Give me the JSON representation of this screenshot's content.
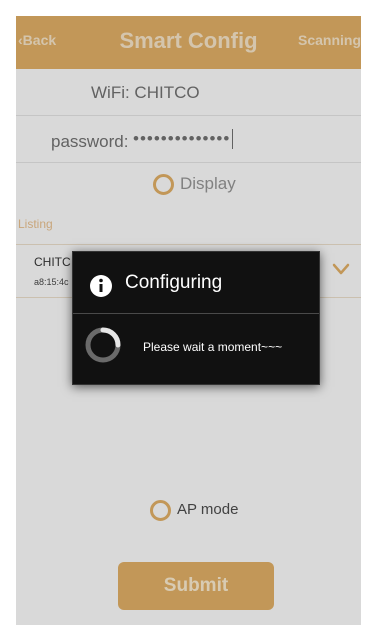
{
  "header": {
    "back_label": "Back",
    "title": "Smart Config",
    "scanning_label": "Scanning",
    "color": "#d9a962"
  },
  "form": {
    "wifi_label": "WiFi: CHITCO",
    "password_label": "password:",
    "password_value": "••••••••••••••",
    "display_label": "Display",
    "listing_label": "Listing"
  },
  "list": {
    "items": [
      {
        "name": "CHITC",
        "mac": "a8:15:4c"
      }
    ]
  },
  "ap_mode_label": "AP mode",
  "submit_label": "Submit",
  "dialog": {
    "title": "Configuring",
    "message": "Please wait a moment~~~",
    "icons": [
      "info-icon",
      "spinner-icon"
    ]
  },
  "colors": {
    "accent": "#d9a962",
    "dialog_bg": "#111111"
  }
}
